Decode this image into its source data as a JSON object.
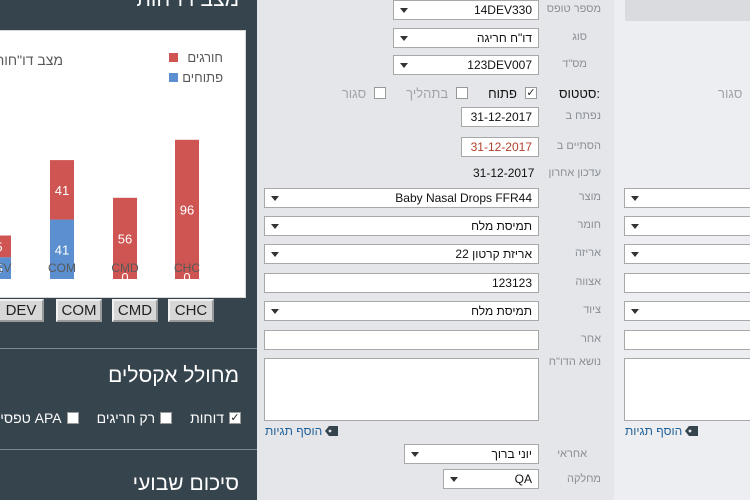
{
  "left_panel": {
    "header_title": "מצב דו\"חות",
    "chart_buttons": [
      "DEV",
      "COM",
      "CMD",
      "CHC"
    ],
    "excel_section_title": "מחולל אקסלים",
    "excel_options": [
      {
        "label": "דוחות",
        "checked": true
      },
      {
        "label": "רק חריגים",
        "checked": false
      },
      {
        "label": "טפסי APA",
        "checked": false
      }
    ],
    "weekly_title": "סיכום שבועי"
  },
  "chart_data": {
    "type": "bar",
    "title": "מצב דו\"חות",
    "categories": [
      "DEV",
      "COM",
      "CMD",
      "CHC"
    ],
    "series": [
      {
        "name": "פתוחים",
        "color": "#5b8fcf",
        "values": [
          15,
          41,
          0,
          0
        ]
      },
      {
        "name": "חורגים",
        "color": "#cf5552",
        "values": [
          15,
          41,
          56,
          96
        ]
      }
    ],
    "visible_labels": {
      "DEV": [
        "5",
        "5"
      ],
      "COM": [
        "41",
        "41"
      ],
      "CMD": [
        "0",
        "56"
      ],
      "CHC": [
        "0",
        "96"
      ]
    },
    "ylim": [
      0,
      100
    ],
    "legend_position": "top-right",
    "visible_category_labels": [
      "DEV",
      "COM",
      "CMD",
      "CHC"
    ]
  },
  "form": {
    "top_value": "14DEV330",
    "top_label": "מספר טופס",
    "type_label": "סוג",
    "type_value": "דו\"ח חריגה",
    "number_label": "מס\"ד",
    "number_value": "123DEV007",
    "status_label": "סטטוס:",
    "status_options": [
      {
        "label": "פתוח",
        "checked": true,
        "muted": false
      },
      {
        "label": "בתהליך",
        "checked": false,
        "muted": true
      },
      {
        "label": "סגור",
        "checked": false,
        "muted": true
      }
    ],
    "opened_label": "נפתח ב",
    "opened_value": "31-12-2017",
    "closed_label": "הסתיים ב",
    "closed_value": "31-12-2017",
    "updated_label": "עדכון אחרון",
    "updated_value": "31-12-2017",
    "product_label": "מוצר",
    "product_value": "Baby Nasal Drops FFR44",
    "material_label": "חומר",
    "material_value": "תמיסת מלח",
    "packaging_label": "אריזה",
    "packaging_value": "אריזת קרטון 22",
    "batch_label": "אצווה",
    "batch_value": "123123",
    "equipment_label": "ציוד",
    "equipment_value": "תמיסת מלח",
    "other_label": "אחר",
    "other_value": "",
    "subject_label": "נושא הדו\"ח",
    "add_tags_label": "הוסף תגיות",
    "responsible_label": "אחראי",
    "responsible_value": "יוני ברוך",
    "department_label": "מחלקה",
    "department_value": "QA"
  },
  "right_panel": {
    "closed_label": "סגור",
    "add_tags_label": "הוסף תגיות"
  }
}
